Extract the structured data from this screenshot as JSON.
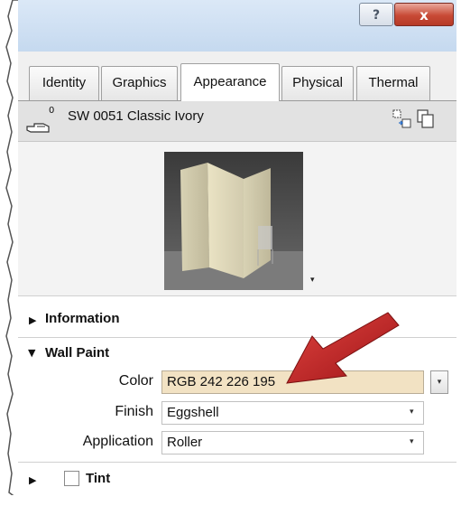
{
  "titlebar": {
    "help_label": "?",
    "close_label": "x"
  },
  "tabs": [
    {
      "label": "Identity",
      "active": false
    },
    {
      "label": "Graphics",
      "active": false
    },
    {
      "label": "Appearance",
      "active": true
    },
    {
      "label": "Physical",
      "active": false
    },
    {
      "label": "Thermal",
      "active": false
    }
  ],
  "material": {
    "count": "0",
    "name": "SW 0051 Classic Ivory",
    "icons": [
      "hand-icon",
      "duplicate-asset-icon",
      "replace-asset-icon"
    ]
  },
  "preview": {
    "dropdown_glyph": "▾"
  },
  "sections": {
    "information": {
      "label": "Information",
      "expanded": false
    },
    "wall_paint": {
      "label": "Wall Paint",
      "expanded": true,
      "properties": {
        "color": {
          "label": "Color",
          "value": "RGB 242 226 195",
          "swatch": "#f2e2c3"
        },
        "finish": {
          "label": "Finish",
          "value": "Eggshell"
        },
        "application": {
          "label": "Application",
          "value": "Roller"
        }
      }
    },
    "tint": {
      "label": "Tint",
      "expanded": false,
      "checked": false
    }
  },
  "colors": {
    "annotation_arrow": "#c8262b",
    "titlebar": "#cfe0f3",
    "close_button": "#c84a36"
  }
}
